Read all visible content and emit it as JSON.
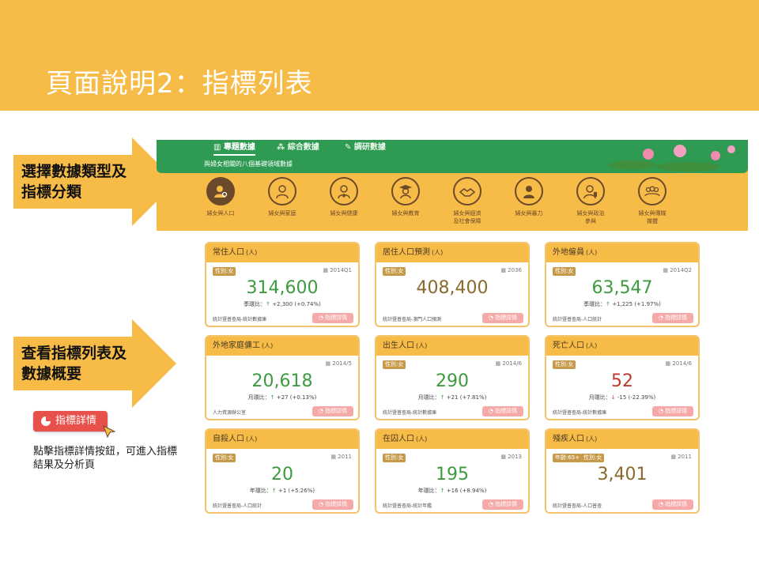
{
  "slide": {
    "title": "頁面說明2：指標列表",
    "arrow1_text": "選擇數據類型及\n指標分類",
    "arrow2_text": "查看指標列表及\n數據概要",
    "sample_button": "指標詳情",
    "note": "點擊指標詳情按鈕，可進入指標結果及分析頁",
    "colors": {
      "header": "#f7bb47",
      "nav_green": "#2e9a52",
      "detail_button": "#e8504b"
    }
  },
  "site": {
    "tabs": [
      {
        "icon": "bar-chart-icon",
        "label": "專題數據"
      },
      {
        "icon": "network-icon",
        "label": "綜合數據"
      },
      {
        "icon": "edit-icon",
        "label": "調研數據"
      }
    ],
    "subtitle": "與婦女相關的八個基礎領域數據",
    "categories": [
      {
        "label": "婦女與人口",
        "icon": "person-search-icon"
      },
      {
        "label": "婦女與家庭",
        "icon": "woman-icon"
      },
      {
        "label": "婦女與健康",
        "icon": "doctor-icon"
      },
      {
        "label": "婦女與教育",
        "icon": "graduate-icon"
      },
      {
        "label": "婦女與經濟\n及社會保障",
        "icon": "handshake-icon"
      },
      {
        "label": "婦女與暴力",
        "icon": "person-icon"
      },
      {
        "label": "婦女與政治\n參與",
        "icon": "speaker-icon"
      },
      {
        "label": "婦女與傳媒\n媒體",
        "icon": "group-icon"
      }
    ],
    "cards": [
      {
        "title": "常住人口",
        "unit": "(人)",
        "tags": [
          "性別:女"
        ],
        "date": "2014Q1",
        "value": "314,600",
        "color": "green",
        "change_label": "季環比：",
        "change_dir": "up",
        "change": "+2,300 (+0.74%)",
        "source": "統計暨普查局-統計數據庫",
        "button": "指標詳情"
      },
      {
        "title": "居住人口預測",
        "unit": "(人)",
        "tags": [
          "性別:女"
        ],
        "date": "2036",
        "value": "408,400",
        "color": "brown",
        "change_label": "",
        "change_dir": "",
        "change": "",
        "source": "統計暨普查局-澳門人口預測",
        "button": "指標詳情"
      },
      {
        "title": "外地僱員",
        "unit": "(人)",
        "tags": [
          "性別:女"
        ],
        "date": "2014Q2",
        "value": "63,547",
        "color": "green",
        "change_label": "季環比：",
        "change_dir": "up",
        "change": "+1,225 (+1.97%)",
        "source": "統計暨普查局-人口統計",
        "button": "指標詳情"
      },
      {
        "title": "外地家庭傭工",
        "unit": "(人)",
        "tags": [],
        "date": "2014/5",
        "value": "20,618",
        "color": "green",
        "change_label": "月環比：",
        "change_dir": "up",
        "change": "+27 (+0.13%)",
        "source": "人力資源辦公室",
        "button": "指標詳情"
      },
      {
        "title": "出生人口",
        "unit": "(人)",
        "tags": [
          "性別:女"
        ],
        "date": "2014/6",
        "value": "290",
        "color": "green",
        "change_label": "月環比：",
        "change_dir": "up",
        "change": "+21 (+7.81%)",
        "source": "統計暨普查局-統計數據庫",
        "button": "指標詳情"
      },
      {
        "title": "死亡人口",
        "unit": "(人)",
        "tags": [
          "性別:女"
        ],
        "date": "2014/6",
        "value": "52",
        "color": "red",
        "change_label": "月環比：",
        "change_dir": "down",
        "change": "-15 (-22.39%)",
        "source": "統計暨普查局-統計數據庫",
        "button": "指標詳情"
      },
      {
        "title": "自殺人口",
        "unit": "(人)",
        "tags": [
          "性別:女"
        ],
        "date": "2011",
        "value": "20",
        "color": "green",
        "change_label": "年環比：",
        "change_dir": "up",
        "change": "+1 (+5.26%)",
        "source": "統計暨普查局-人口統計",
        "button": "指標詳情"
      },
      {
        "title": "在囚人口",
        "unit": "(人)",
        "tags": [
          "性別:女"
        ],
        "date": "2013",
        "value": "195",
        "color": "green",
        "change_label": "年環比：",
        "change_dir": "up",
        "change": "+16 (+8.94%)",
        "source": "統計暨普查局-統計年鑑",
        "button": "指標詳情"
      },
      {
        "title": "殘疾人口",
        "unit": "(人)",
        "tags": [
          "年齡:65+",
          "性別:女"
        ],
        "date": "2011",
        "value": "3,401",
        "color": "brown",
        "change_label": "",
        "change_dir": "",
        "change": "",
        "source": "統計暨普查局-人口普查",
        "button": "指標詳情"
      }
    ]
  }
}
